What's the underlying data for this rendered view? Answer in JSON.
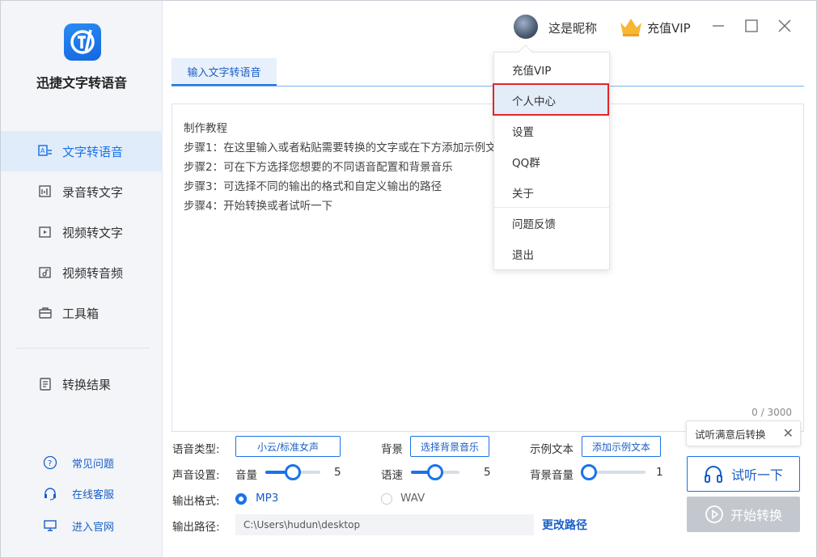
{
  "app": {
    "name": "迅捷文字转语音"
  },
  "sidebar": {
    "items": [
      {
        "label": "文字转语音",
        "icon": "text-to-speech-icon",
        "active": true
      },
      {
        "label": "录音转文字",
        "icon": "audio-to-text-icon"
      },
      {
        "label": "视频转文字",
        "icon": "video-to-text-icon"
      },
      {
        "label": "视频转音频",
        "icon": "video-to-audio-icon"
      },
      {
        "label": "工具箱",
        "icon": "toolbox-icon"
      }
    ],
    "result": {
      "label": "转换结果",
      "icon": "result-icon"
    },
    "help": [
      {
        "label": "常见问题",
        "icon": "question-icon"
      },
      {
        "label": "在线客服",
        "icon": "headset-icon"
      },
      {
        "label": "进入官网",
        "icon": "monitor-icon"
      }
    ]
  },
  "header": {
    "nickname": "这是昵称",
    "vip_label": "充值VIP"
  },
  "dropdown": {
    "items": [
      "充值VIP",
      "个人中心",
      "设置",
      "QQ群",
      "关于",
      "问题反馈",
      "退出"
    ],
    "highlighted": "个人中心"
  },
  "tabs": [
    {
      "label": "输入文字转语音",
      "active": true
    }
  ],
  "editor": {
    "lines": [
      "制作教程",
      "步骤1：在这里输入或者粘贴需要转换的文字或在下方添加示例文本",
      "步骤2：可在下方选择您想要的不同语音配置和背景音乐",
      "步骤3：可选择不同的输出的格式和自定义输出的路径",
      "步骤4：开始转换或者试听一下"
    ],
    "counter": "0 / 3000"
  },
  "settings": {
    "voice_type_label": "语音类型:",
    "voice_type_value": "小云/标准女声",
    "background_label": "背景",
    "background_button": "选择背景音乐",
    "sample_label": "示例文本",
    "sample_button": "添加示例文本",
    "sound_label": "声音设置:",
    "volume_label": "音量",
    "volume_value": "5",
    "volume_fraction": 0.5,
    "speed_label": "语速",
    "speed_value": "5",
    "speed_fraction": 0.5,
    "bg_volume_label": "背景音量",
    "bg_volume_value": "1",
    "bg_volume_fraction": 0.0,
    "format_label": "输出格式:",
    "format_options": [
      "MP3",
      "WAV"
    ],
    "format_selected": "MP3",
    "path_label": "输出路径:",
    "path_value": "C:\\Users\\hudun\\desktop",
    "change_path": "更改路径"
  },
  "actions": {
    "tooltip": "试听满意后转换",
    "listen": "试听一下",
    "start": "开始转换"
  },
  "colors": {
    "accent": "#1a73e8",
    "highlight_border": "#e0262a",
    "disabled": "#c3c8cf"
  }
}
